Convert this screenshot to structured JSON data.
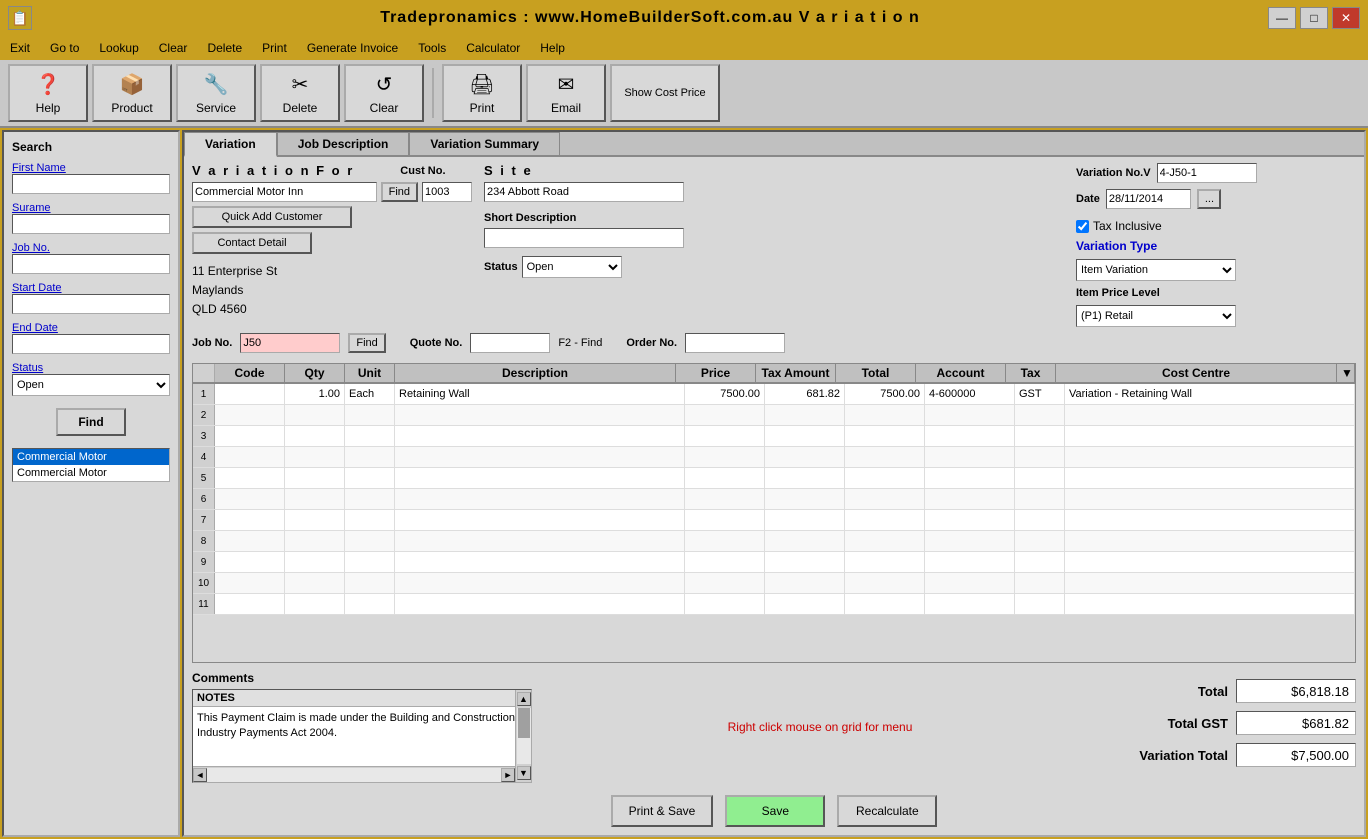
{
  "window": {
    "title": "Tradepronamics :  www.HomeBuilderSoft.com.au    V a r i a t i o n",
    "icon": "📋"
  },
  "titlebar": {
    "minimize": "—",
    "maximize": "□",
    "close": "✕"
  },
  "menubar": {
    "items": [
      "Exit",
      "Go to",
      "Lookup",
      "Clear",
      "Delete",
      "Print",
      "Generate Invoice",
      "Tools",
      "Calculator",
      "Help"
    ]
  },
  "toolbar": {
    "buttons": [
      {
        "id": "help",
        "icon": "❓",
        "label": "Help"
      },
      {
        "id": "product",
        "icon": "📦",
        "label": "Product"
      },
      {
        "id": "service",
        "icon": "🔧",
        "label": "Service"
      },
      {
        "id": "delete",
        "icon": "✂",
        "label": "Delete"
      },
      {
        "id": "clear",
        "icon": "↺",
        "label": "Clear"
      },
      {
        "id": "print",
        "icon": "🖨",
        "label": "Print"
      },
      {
        "id": "email",
        "icon": "✉",
        "label": "Email"
      },
      {
        "id": "show-cost-price",
        "icon": "",
        "label": "Show Cost Price"
      }
    ]
  },
  "tabs": {
    "items": [
      "Variation",
      "Job Description",
      "Variation Summary"
    ],
    "active": 0
  },
  "form": {
    "variation_for_label": "V a r i a t i o n   F o r",
    "cust_no_label": "Cust No.",
    "site_label": "S i t e",
    "customer_name": "Commercial Motor Inn",
    "cust_no": "1003",
    "site_address": "234 Abbott Road",
    "find_btn": "Find",
    "quick_add_btn": "Quick Add Customer",
    "contact_detail_btn": "Contact Detail",
    "address_line1": "11 Enterprise St",
    "address_line2": "Maylands",
    "address_line3": "QLD  4560",
    "variation_no_label": "Variation No.V",
    "variation_no": "4-J50-1",
    "date_label": "Date",
    "date_value": "28/11/2014",
    "short_desc_label": "Short Description",
    "short_desc": "",
    "tax_inclusive_label": "Tax Inclusive",
    "tax_inclusive_checked": true,
    "variation_type_label": "Variation Type",
    "variation_type": "Item Variation",
    "item_price_level_label": "Item Price Level",
    "item_price_level": "(P1) Retail",
    "status_label": "Status",
    "status_value": "Open",
    "job_no_label": "Job No.",
    "job_no": "J50",
    "job_find_btn": "Find",
    "quote_no_label": "Quote No.",
    "quote_no": "",
    "f2_find": "F2 - Find",
    "order_no_label": "Order No.",
    "order_no": ""
  },
  "grid": {
    "headers": [
      "",
      "Code",
      "Qty",
      "Unit",
      "Description",
      "Price",
      "Tax Amount",
      "Total",
      "Account",
      "Tax",
      "Cost Centre",
      "▼"
    ],
    "rows": [
      {
        "num": "1",
        "code": "",
        "qty": "1.00",
        "unit": "Each",
        "description": "Retaining Wall",
        "price": "7500.00",
        "tax_amount": "681.82",
        "total": "7500.00",
        "account": "4-600000",
        "tax": "GST",
        "cost_centre": "Variation - Retaining Wall"
      },
      {
        "num": "2",
        "code": "",
        "qty": "",
        "unit": "",
        "description": "",
        "price": "",
        "tax_amount": "",
        "total": "",
        "account": "",
        "tax": "",
        "cost_centre": ""
      },
      {
        "num": "3",
        "code": "",
        "qty": "",
        "unit": "",
        "description": "",
        "price": "",
        "tax_amount": "",
        "total": "",
        "account": "",
        "tax": "",
        "cost_centre": ""
      },
      {
        "num": "4",
        "code": "",
        "qty": "",
        "unit": "",
        "description": "",
        "price": "",
        "tax_amount": "",
        "total": "",
        "account": "",
        "tax": "",
        "cost_centre": ""
      },
      {
        "num": "5",
        "code": "",
        "qty": "",
        "unit": "",
        "description": "",
        "price": "",
        "tax_amount": "",
        "total": "",
        "account": "",
        "tax": "",
        "cost_centre": ""
      },
      {
        "num": "6",
        "code": "",
        "qty": "",
        "unit": "",
        "description": "",
        "price": "",
        "tax_amount": "",
        "total": "",
        "account": "",
        "tax": "",
        "cost_centre": ""
      },
      {
        "num": "7",
        "code": "",
        "qty": "",
        "unit": "",
        "description": "",
        "price": "",
        "tax_amount": "",
        "total": "",
        "account": "",
        "tax": "",
        "cost_centre": ""
      },
      {
        "num": "8",
        "code": "",
        "qty": "",
        "unit": "",
        "description": "",
        "price": "",
        "tax_amount": "",
        "total": "",
        "account": "",
        "tax": "",
        "cost_centre": ""
      },
      {
        "num": "9",
        "code": "",
        "qty": "",
        "unit": "",
        "description": "",
        "price": "",
        "tax_amount": "",
        "total": "",
        "account": "",
        "tax": "",
        "cost_centre": ""
      },
      {
        "num": "10",
        "code": "",
        "qty": "",
        "unit": "",
        "description": "",
        "price": "",
        "tax_amount": "",
        "total": "",
        "account": "",
        "tax": "",
        "cost_centre": ""
      },
      {
        "num": "11",
        "code": "",
        "qty": "",
        "unit": "",
        "description": "",
        "price": "",
        "tax_amount": "",
        "total": "",
        "account": "",
        "tax": "",
        "cost_centre": ""
      }
    ]
  },
  "comments": {
    "label": "Comments",
    "notes_label": "NOTES",
    "text": "This Payment Claim is made under the Building and Construction Industry Payments Act 2004."
  },
  "hint": "Right click mouse on grid for menu",
  "totals": {
    "total_label": "Total",
    "total_value": "$6,818.18",
    "total_gst_label": "Total GST",
    "total_gst_value": "$681.82",
    "variation_total_label": "Variation Total",
    "variation_total_value": "$7,500.00"
  },
  "action_buttons": {
    "print_save": "Print & Save",
    "save": "Save",
    "recalculate": "Recalculate"
  },
  "search": {
    "title": "Search",
    "first_name_label": "First Name",
    "surname_label": "Surame",
    "job_no_label": "Job No.",
    "start_date_label": "Start Date",
    "end_date_label": "End Date",
    "status_label": "Status",
    "status_value": "Open",
    "find_btn": "Find",
    "results": [
      "Commercial Motor",
      "Commercial Motor"
    ],
    "selected_index": 0
  }
}
